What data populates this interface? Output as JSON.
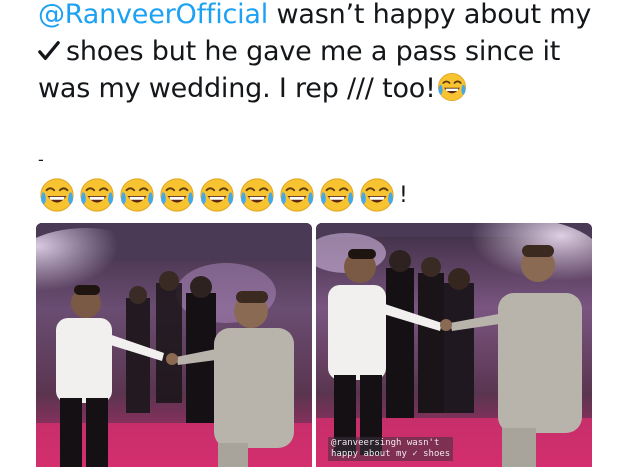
{
  "tweet": {
    "mention": "@RanveerOfficial",
    "line1_rest": " wasn’t happy about my",
    "line2": "shoes but he gave me a pass since it",
    "line3": "was my wedding. I rep /// too!",
    "dash": "-",
    "emoji_count": 9,
    "trailing": "!",
    "mention_color": "#1da1f2"
  },
  "photos": {
    "left": {
      "icon": "party-dance-photo"
    },
    "right": {
      "icon": "party-dance-photo",
      "caption": "@ranveersingh wasn't\nhappy about my ✓ shoes"
    }
  }
}
